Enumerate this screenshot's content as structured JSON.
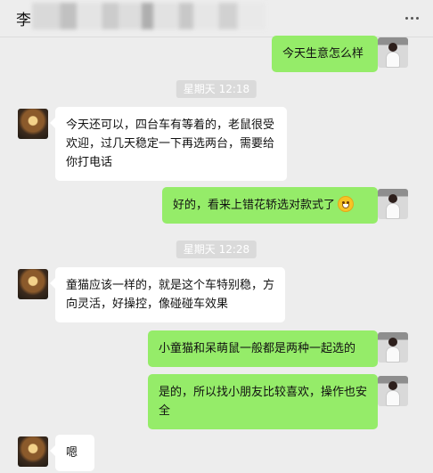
{
  "header": {
    "title": "李"
  },
  "messages": [
    {
      "side": "right",
      "text": "今天生意怎么样"
    },
    {
      "type": "time",
      "text": "星期天 12:18"
    },
    {
      "side": "left",
      "text": "今天还可以，四台车有等着的，老鼠很受欢迎，过几天稳定一下再选两台，需要给你打电话"
    },
    {
      "side": "right",
      "text": "好的，看来上错花轿选对款式了",
      "emoji": "grinning-face-emoji"
    },
    {
      "type": "time",
      "text": "星期天 12:28"
    },
    {
      "side": "left",
      "text": "童猫应该一样的，就是这个车特别稳，方向灵活，好操控，像碰碰车效果"
    },
    {
      "side": "right",
      "text": "小童猫和呆萌鼠一般都是两种一起选的"
    },
    {
      "side": "right",
      "text": "是的，所以找小朋友比较喜欢，操作也安全"
    },
    {
      "side": "left",
      "text": "嗯"
    }
  ],
  "colors": {
    "background": "#ededed",
    "outgoing_bubble": "#95ec69",
    "incoming_bubble": "#ffffff",
    "time_badge": "#dadada"
  }
}
